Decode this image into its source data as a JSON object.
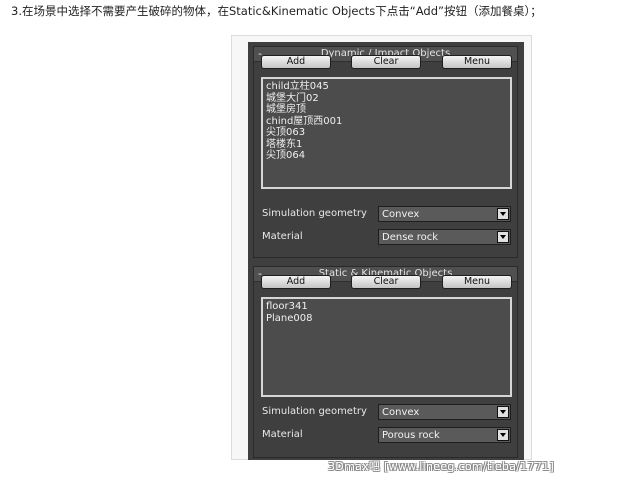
{
  "caption": "3.在场景中选择不需要产生破碎的物体，在Static&Kinematic Objects下点击“Add”按钮（添加餐桌）；",
  "dynamic_rollout": {
    "collapse": "-",
    "title": "Dynamic / Impact Objects",
    "add_label": "Add",
    "clear_label": "Clear",
    "menu_label": "Menu",
    "items": [
      "child立柱045",
      "城堡大门02",
      "城堡房顶",
      "chind屋顶西001",
      "尖顶063",
      "塔楼东1",
      "尖顶064"
    ],
    "sim_geometry_label": "Simulation geometry",
    "sim_geometry_value": "Convex",
    "material_label": "Material",
    "material_value": "Dense rock"
  },
  "static_rollout": {
    "collapse": "-",
    "title": "Static & Kinematic Objects",
    "add_label": "Add",
    "clear_label": "Clear",
    "menu_label": "Menu",
    "items": [
      "floor341",
      "Plane008"
    ],
    "sim_geometry_label": "Simulation geometry",
    "sim_geometry_value": "Convex",
    "material_label": "Material",
    "material_value": "Porous rock"
  },
  "watermark": "3Dmax吧 [www.lineeg.com/tieba/1771]"
}
